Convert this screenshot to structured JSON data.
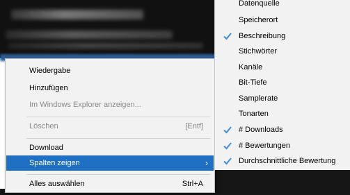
{
  "context_menu": {
    "items": [
      {
        "label": "Wiedergabe",
        "shortcut": "",
        "disabled": false
      },
      {
        "label": "Hinzufügen",
        "shortcut": "",
        "disabled": false
      },
      {
        "label": "Im Windows Explorer anzeigen...",
        "shortcut": "",
        "disabled": true
      },
      {
        "label": "Löschen",
        "shortcut": "[Entf]",
        "disabled": true
      },
      {
        "label": "Download",
        "shortcut": "",
        "disabled": false
      },
      {
        "label": "Spalten zeigen",
        "shortcut": "",
        "disabled": false,
        "highlighted": true,
        "submenu_icon": "chevron-right-icon"
      },
      {
        "label": "Alles auswählen",
        "shortcut": "Strl+A",
        "disabled": false
      }
    ]
  },
  "columns_submenu": {
    "items": [
      {
        "label": "Datenquelle",
        "checked": false
      },
      {
        "label": "Speicherort",
        "checked": false
      },
      {
        "label": "Beschreibung",
        "checked": true
      },
      {
        "label": "Stichwörter",
        "checked": false
      },
      {
        "label": "Kanäle",
        "checked": false
      },
      {
        "label": "Bit-Tiefe",
        "checked": false
      },
      {
        "label": "Samplerate",
        "checked": false
      },
      {
        "label": "Tonarten",
        "checked": false
      },
      {
        "label": "# Downloads",
        "checked": true
      },
      {
        "label": "# Bewertungen",
        "checked": true
      },
      {
        "label": "Durchschnittliche Bewertung",
        "checked": true
      }
    ]
  },
  "colors": {
    "highlight": "#1f6fc2",
    "check": "#3a8ee6",
    "menu_background": "#f2f2f2",
    "disabled_text": "#8a8a8a"
  }
}
